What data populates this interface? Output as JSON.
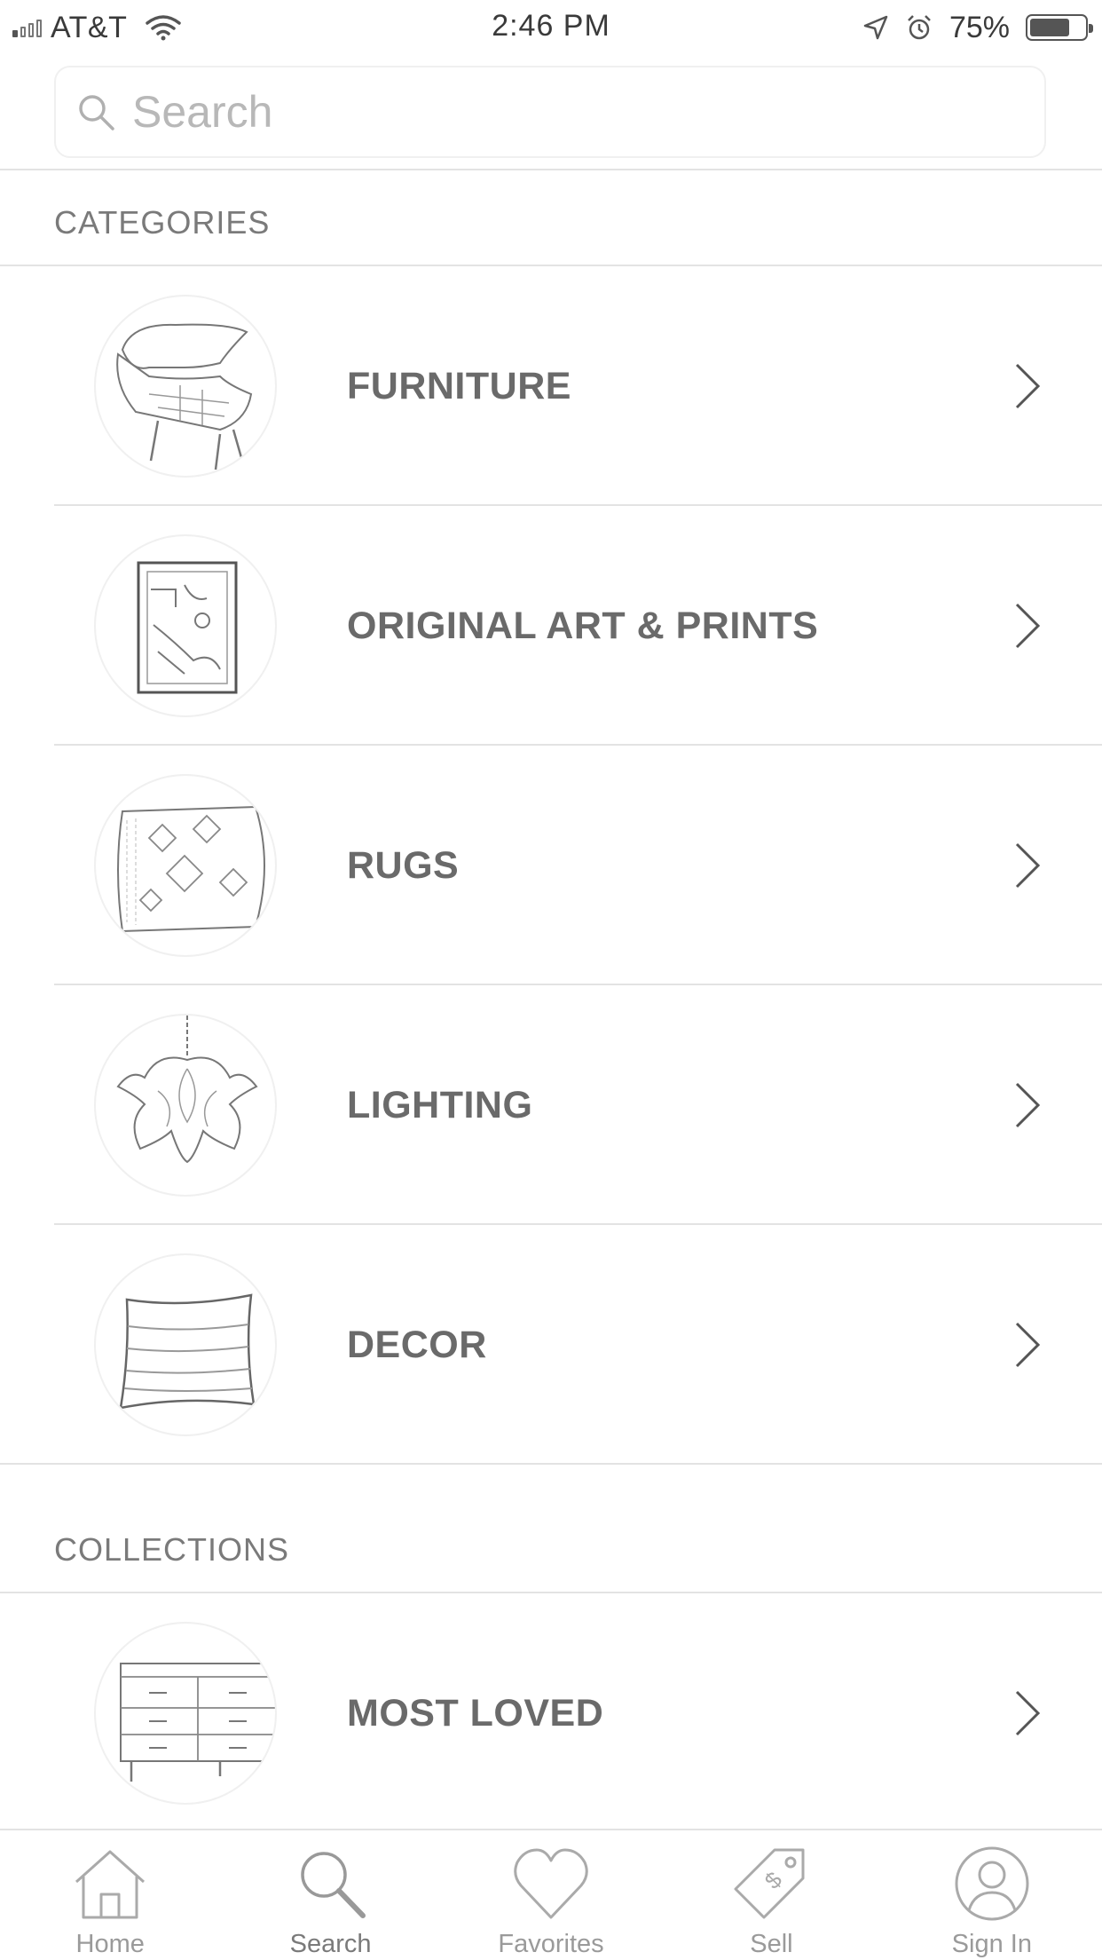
{
  "status_bar": {
    "carrier": "AT&T",
    "time": "2:46 PM",
    "battery": "75%",
    "battery_level": 0.75,
    "icons": [
      "signal-icon",
      "wifi-icon",
      "location-arrow-icon",
      "alarm-icon",
      "battery-icon"
    ]
  },
  "search": {
    "placeholder": "Search",
    "value": ""
  },
  "categories": {
    "header": "CATEGORIES",
    "items": [
      {
        "label": "FURNITURE",
        "thumbnail": "chair-image"
      },
      {
        "label": "ORIGINAL ART & PRINTS",
        "thumbnail": "framed-print-image"
      },
      {
        "label": "RUGS",
        "thumbnail": "rug-image"
      },
      {
        "label": "LIGHTING",
        "thumbnail": "chandelier-image"
      },
      {
        "label": "DECOR",
        "thumbnail": "pillow-image"
      }
    ]
  },
  "collections": {
    "header": "COLLECTIONS",
    "items": [
      {
        "label": "MOST LOVED",
        "thumbnail": "dresser-image"
      }
    ]
  },
  "tab_bar": {
    "active": "Search",
    "tabs": [
      {
        "label": "Home",
        "icon": "home-icon"
      },
      {
        "label": "Search",
        "icon": "search-icon"
      },
      {
        "label": "Favorites",
        "icon": "heart-icon"
      },
      {
        "label": "Sell",
        "icon": "price-tag-icon"
      },
      {
        "label": "Sign In",
        "icon": "user-icon"
      }
    ]
  },
  "colors": {
    "text": "#6a6a6a",
    "section_header": "#7a7a7a",
    "divider": "#e3e3e3",
    "tab_label": "#9a9a9a",
    "background": "#ffffff"
  }
}
